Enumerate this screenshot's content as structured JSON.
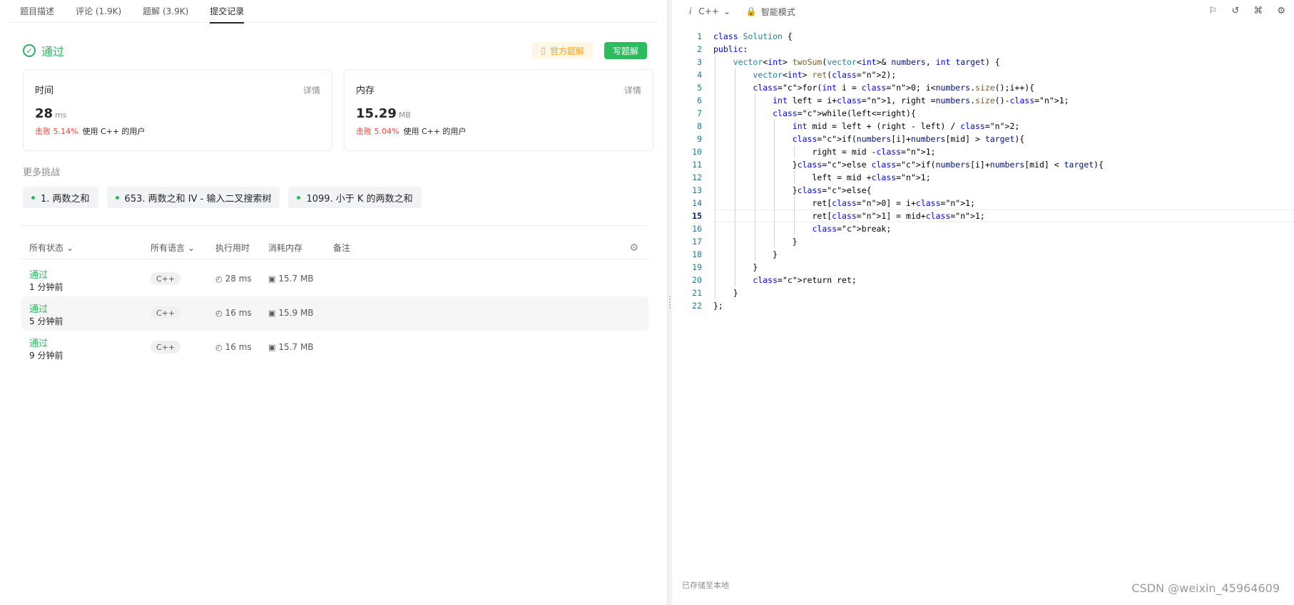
{
  "tabs": [
    {
      "label": "题目描述"
    },
    {
      "label": "评论 (1.9K)"
    },
    {
      "label": "题解 (3.9K)"
    },
    {
      "label": "提交记录"
    }
  ],
  "result": {
    "status": "通过",
    "official_solution_label": "官方题解",
    "write_solution_label": "写题解"
  },
  "cards": [
    {
      "title": "时间",
      "detail": "详情",
      "value": "28",
      "unit": "ms",
      "beat": "击败 5.14%",
      "beat_suffix": "使用 C++ 的用户"
    },
    {
      "title": "内存",
      "detail": "详情",
      "value": "15.29",
      "unit": "MB",
      "beat": "击败 5.04%",
      "beat_suffix": "使用 C++ 的用户"
    }
  ],
  "more": {
    "title": "更多挑战",
    "items": [
      {
        "label": "1. 两数之和"
      },
      {
        "label": "653. 两数之和 IV - 输入二叉搜索树"
      },
      {
        "label": "1099. 小于 K 的两数之和"
      }
    ]
  },
  "table": {
    "headers": {
      "status": "所有状态",
      "language": "所有语言",
      "runtime": "执行用时",
      "memory": "消耗内存",
      "notes": "备注"
    },
    "rows": [
      {
        "status": "通过",
        "time": "1 分钟前",
        "language": "C++",
        "runtime": "28 ms",
        "memory": "15.7 MB"
      },
      {
        "status": "通过",
        "time": "5 分钟前",
        "language": "C++",
        "runtime": "16 ms",
        "memory": "15.9 MB"
      },
      {
        "status": "通过",
        "time": "9 分钟前",
        "language": "C++",
        "runtime": "16 ms",
        "memory": "15.7 MB"
      }
    ]
  },
  "editor": {
    "language": "C++",
    "mode": "智能模式",
    "saved_label": "已存储至本地",
    "current_line": 15,
    "lines": [
      "class Solution {",
      "public:",
      "    vector<int> twoSum(vector<int>& numbers, int target) {",
      "        vector<int> ret(2);",
      "        for(int i = 0; i<numbers.size();i++){",
      "            int left = i+1, right =numbers.size()-1;",
      "            while(left<=right){",
      "                int mid = left + (right - left) / 2;",
      "                if(numbers[i]+numbers[mid] > target){",
      "                    right = mid -1;",
      "                }else if(numbers[i]+numbers[mid] < target){",
      "                    left = mid +1;",
      "                }else{",
      "                    ret[0] = i+1;",
      "                    ret[1] = mid+1;",
      "                    break;",
      "                }",
      "            }",
      "        }",
      "        return ret;",
      "    }",
      "};"
    ]
  },
  "watermark": "CSDN @weixin_45964609",
  "colors": {
    "accent_green": "#2db55d",
    "beat_red": "#ef4743",
    "official_orange": "#ffa116"
  },
  "icons": [
    "check-circle-icon",
    "book-icon",
    "chevron-down-icon",
    "gear-icon",
    "clock-icon",
    "chip-icon",
    "lock-icon",
    "bookmark-icon",
    "reset-icon",
    "command-icon"
  ]
}
